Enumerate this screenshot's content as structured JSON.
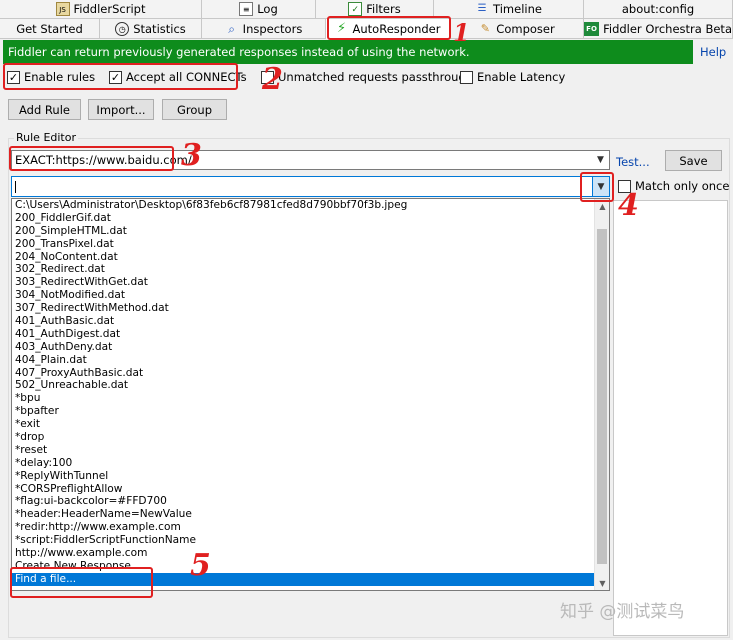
{
  "tabs_row1": [
    {
      "label": "FiddlerScript",
      "icon": "js-script-icon"
    },
    {
      "label": "Log",
      "icon": "log-icon"
    },
    {
      "label": "Filters",
      "icon": "filters-checkbox-icon"
    },
    {
      "label": "Timeline",
      "icon": "timeline-icon"
    },
    {
      "label": "about:config",
      "icon": ""
    }
  ],
  "tabs_row2": [
    {
      "label": "Get Started",
      "icon": ""
    },
    {
      "label": "Statistics",
      "icon": "stopwatch-icon"
    },
    {
      "label": "Inspectors",
      "icon": "inspectors-icon"
    },
    {
      "label": "AutoResponder",
      "icon": "lightning-icon",
      "active": true
    },
    {
      "label": "Composer",
      "icon": "composer-icon"
    },
    {
      "label": "Fiddler Orchestra Beta",
      "icon": "fo-icon",
      "icon_text": "FO"
    }
  ],
  "info_bar": {
    "text": "Fiddler can return previously generated responses instead of using the network.",
    "help": "Help"
  },
  "options": {
    "enable_rules": {
      "label": "Enable rules",
      "checked": true
    },
    "accept_connects": {
      "label": "Accept all CONNECTs",
      "checked": true
    },
    "unmatched_passthrough": {
      "label": "Unmatched requests passthrough",
      "checked": false
    },
    "enable_latency": {
      "label": "Enable Latency",
      "checked": false
    }
  },
  "buttons": {
    "add_rule": "Add Rule",
    "import": "Import...",
    "group": "Group"
  },
  "rule_editor": {
    "label": "Rule Editor",
    "match_value": "EXACT:https://www.baidu.com/",
    "action_value": "",
    "test_link": "Test...",
    "save": "Save",
    "match_only_once": "Match only once"
  },
  "dropdown_items": [
    "C:\\Users\\Administrator\\Desktop\\6f83feb6cf87981cfed8d790bbf70f3b.jpeg",
    "200_FiddlerGif.dat",
    "200_SimpleHTML.dat",
    "200_TransPixel.dat",
    "204_NoContent.dat",
    "302_Redirect.dat",
    "303_RedirectWithGet.dat",
    "304_NotModified.dat",
    "307_RedirectWithMethod.dat",
    "401_AuthBasic.dat",
    "401_AuthDigest.dat",
    "403_AuthDeny.dat",
    "404_Plain.dat",
    "407_ProxyAuthBasic.dat",
    "502_Unreachable.dat",
    "*bpu",
    "*bpafter",
    "*exit",
    "*drop",
    "*reset",
    "*delay:100",
    "*ReplyWithTunnel",
    "*CORSPreflightAllow",
    "*flag:ui-backcolor=#FFD700",
    "*header:HeaderName=NewValue",
    "*redir:http://www.example.com",
    "*script:FiddlerScriptFunctionName",
    "http://www.example.com",
    "Create New Response...",
    "Find a file..."
  ],
  "selected_index": 29,
  "annotations": [
    "1",
    "2",
    "3",
    "4",
    "5"
  ],
  "watermark": "知乎 @测试菜鸟",
  "colors": {
    "info_bar": "#0e8c1c",
    "selection": "#0078d7",
    "annotation": "#e02020",
    "link": "#0645ad"
  }
}
